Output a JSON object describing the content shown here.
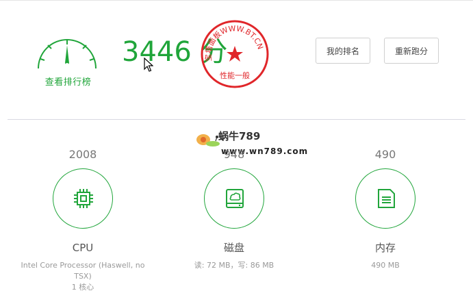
{
  "score": {
    "value": "3446 分"
  },
  "gauge": {
    "caption": "查看排行榜"
  },
  "stamp": {
    "arc_text": "宝塔面板WWW.BT.CN",
    "bottom_text": "性能一般"
  },
  "buttons": {
    "rank": "我的排名",
    "retest": "重新跑分"
  },
  "watermark": {
    "title": "蜗牛789",
    "url": "www.wn789.com"
  },
  "cards": [
    {
      "value": "2008",
      "name": "CPU",
      "desc": "Intel Core Processor (Haswell, no TSX)",
      "desc2": "1 核心",
      "icon": "cpu-chip-icon"
    },
    {
      "value": "948",
      "name": "磁盘",
      "desc": "读: 72 MB，写: 86 MB",
      "icon": "hard-disk-icon"
    },
    {
      "value": "490",
      "name": "内存",
      "desc": "490 MB",
      "icon": "memory-card-icon"
    }
  ],
  "colors": {
    "accent": "#20a53a",
    "stamp": "#e0262a"
  }
}
